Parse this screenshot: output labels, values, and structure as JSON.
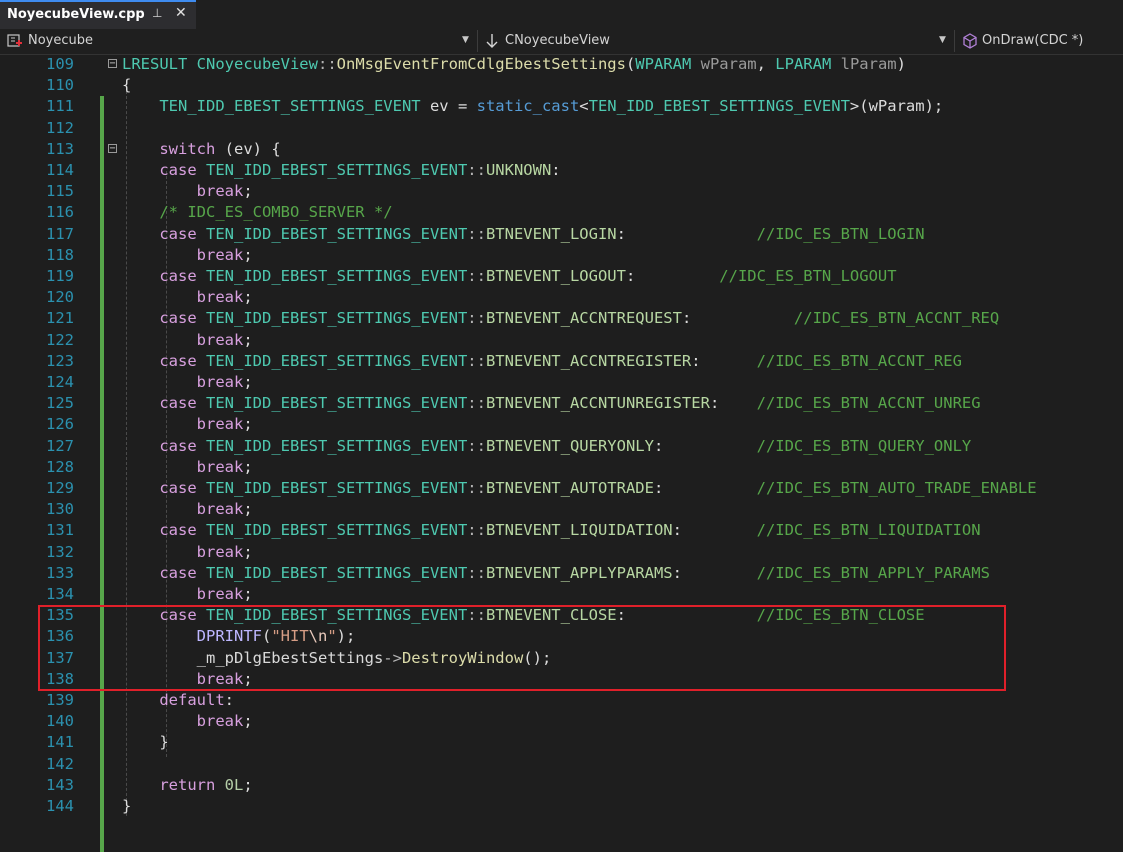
{
  "tab": {
    "title": "NoyecubeView.cpp",
    "pin_glyph": "⊥",
    "close_glyph": "✕"
  },
  "nav": {
    "project": "Noyecube",
    "class": "CNoyecubeView",
    "member": "OnDraw(CDC *)"
  },
  "lines": [
    {
      "n": "109",
      "fold": "minus",
      "segs": [
        [
          "LRESULT ",
          "type"
        ],
        [
          "CNoyecubeView",
          "type"
        ],
        [
          "::",
          "punc"
        ],
        [
          "OnMsgEventFromCdlgEbestSettings",
          "fn"
        ],
        [
          "(",
          "plain"
        ],
        [
          "WPARAM ",
          "type"
        ],
        [
          "wParam",
          "param"
        ],
        [
          ", ",
          "plain"
        ],
        [
          "LPARAM ",
          "type"
        ],
        [
          "lParam",
          "param"
        ],
        [
          ")",
          "plain"
        ]
      ]
    },
    {
      "n": "110",
      "segs": [
        [
          "{",
          "plain"
        ]
      ]
    },
    {
      "n": "111",
      "segs": [
        [
          "    ",
          "plain"
        ],
        [
          "TEN_IDD_EBEST_SETTINGS_EVENT ",
          "type"
        ],
        [
          "ev = ",
          "plain"
        ],
        [
          "static_cast",
          "kw"
        ],
        [
          "<",
          "plain"
        ],
        [
          "TEN_IDD_EBEST_SETTINGS_EVENT",
          "type"
        ],
        [
          ">(wParam);",
          "plain"
        ]
      ]
    },
    {
      "n": "112",
      "segs": []
    },
    {
      "n": "113",
      "fold": "minus",
      "segs": [
        [
          "    ",
          "plain"
        ],
        [
          "switch",
          "kw2"
        ],
        [
          " (ev) {",
          "plain"
        ]
      ]
    },
    {
      "n": "114",
      "segs": [
        [
          "    ",
          "plain"
        ],
        [
          "case ",
          "kw2"
        ],
        [
          "TEN_IDD_EBEST_SETTINGS_EVENT",
          "type"
        ],
        [
          "::",
          "punc"
        ],
        [
          "UNKNOWN",
          "enum"
        ],
        [
          ":",
          "plain"
        ]
      ]
    },
    {
      "n": "115",
      "segs": [
        [
          "        ",
          "plain"
        ],
        [
          "break",
          "kw2"
        ],
        [
          ";",
          "plain"
        ]
      ]
    },
    {
      "n": "116",
      "segs": [
        [
          "    ",
          "plain"
        ],
        [
          "/* IDC_ES_COMBO_SERVER */",
          "cmt"
        ]
      ]
    },
    {
      "n": "117",
      "segs": [
        [
          "    ",
          "plain"
        ],
        [
          "case ",
          "kw2"
        ],
        [
          "TEN_IDD_EBEST_SETTINGS_EVENT",
          "type"
        ],
        [
          "::",
          "punc"
        ],
        [
          "BTNEVENT_LOGIN",
          "enum"
        ],
        [
          ":              ",
          "plain"
        ],
        [
          "//IDC_ES_BTN_LOGIN",
          "cmt"
        ]
      ]
    },
    {
      "n": "118",
      "segs": [
        [
          "        ",
          "plain"
        ],
        [
          "break",
          "kw2"
        ],
        [
          ";",
          "plain"
        ]
      ]
    },
    {
      "n": "119",
      "segs": [
        [
          "    ",
          "plain"
        ],
        [
          "case ",
          "kw2"
        ],
        [
          "TEN_IDD_EBEST_SETTINGS_EVENT",
          "type"
        ],
        [
          "::",
          "punc"
        ],
        [
          "BTNEVENT_LOGOUT",
          "enum"
        ],
        [
          ":         ",
          "plain"
        ],
        [
          "//IDC_ES_BTN_LOGOUT",
          "cmt"
        ]
      ]
    },
    {
      "n": "120",
      "segs": [
        [
          "        ",
          "plain"
        ],
        [
          "break",
          "kw2"
        ],
        [
          ";",
          "plain"
        ]
      ]
    },
    {
      "n": "121",
      "segs": [
        [
          "    ",
          "plain"
        ],
        [
          "case ",
          "kw2"
        ],
        [
          "TEN_IDD_EBEST_SETTINGS_EVENT",
          "type"
        ],
        [
          "::",
          "punc"
        ],
        [
          "BTNEVENT_ACCNTREQUEST",
          "enum"
        ],
        [
          ":           ",
          "plain"
        ],
        [
          "//IDC_ES_BTN_ACCNT_REQ",
          "cmt"
        ]
      ]
    },
    {
      "n": "122",
      "segs": [
        [
          "        ",
          "plain"
        ],
        [
          "break",
          "kw2"
        ],
        [
          ";",
          "plain"
        ]
      ]
    },
    {
      "n": "123",
      "segs": [
        [
          "    ",
          "plain"
        ],
        [
          "case ",
          "kw2"
        ],
        [
          "TEN_IDD_EBEST_SETTINGS_EVENT",
          "type"
        ],
        [
          "::",
          "punc"
        ],
        [
          "BTNEVENT_ACCNTREGISTER",
          "enum"
        ],
        [
          ":      ",
          "plain"
        ],
        [
          "//IDC_ES_BTN_ACCNT_REG",
          "cmt"
        ]
      ]
    },
    {
      "n": "124",
      "segs": [
        [
          "        ",
          "plain"
        ],
        [
          "break",
          "kw2"
        ],
        [
          ";",
          "plain"
        ]
      ]
    },
    {
      "n": "125",
      "segs": [
        [
          "    ",
          "plain"
        ],
        [
          "case ",
          "kw2"
        ],
        [
          "TEN_IDD_EBEST_SETTINGS_EVENT",
          "type"
        ],
        [
          "::",
          "punc"
        ],
        [
          "BTNEVENT_ACCNTUNREGISTER",
          "enum"
        ],
        [
          ":    ",
          "plain"
        ],
        [
          "//IDC_ES_BTN_ACCNT_UNREG",
          "cmt"
        ]
      ]
    },
    {
      "n": "126",
      "segs": [
        [
          "        ",
          "plain"
        ],
        [
          "break",
          "kw2"
        ],
        [
          ";",
          "plain"
        ]
      ]
    },
    {
      "n": "127",
      "segs": [
        [
          "    ",
          "plain"
        ],
        [
          "case ",
          "kw2"
        ],
        [
          "TEN_IDD_EBEST_SETTINGS_EVENT",
          "type"
        ],
        [
          "::",
          "punc"
        ],
        [
          "BTNEVENT_QUERYONLY",
          "enum"
        ],
        [
          ":          ",
          "plain"
        ],
        [
          "//IDC_ES_BTN_QUERY_ONLY",
          "cmt"
        ]
      ]
    },
    {
      "n": "128",
      "segs": [
        [
          "        ",
          "plain"
        ],
        [
          "break",
          "kw2"
        ],
        [
          ";",
          "plain"
        ]
      ]
    },
    {
      "n": "129",
      "segs": [
        [
          "    ",
          "plain"
        ],
        [
          "case ",
          "kw2"
        ],
        [
          "TEN_IDD_EBEST_SETTINGS_EVENT",
          "type"
        ],
        [
          "::",
          "punc"
        ],
        [
          "BTNEVENT_AUTOTRADE",
          "enum"
        ],
        [
          ":          ",
          "plain"
        ],
        [
          "//IDC_ES_BTN_AUTO_TRADE_ENABLE",
          "cmt"
        ]
      ]
    },
    {
      "n": "130",
      "segs": [
        [
          "        ",
          "plain"
        ],
        [
          "break",
          "kw2"
        ],
        [
          ";",
          "plain"
        ]
      ]
    },
    {
      "n": "131",
      "segs": [
        [
          "    ",
          "plain"
        ],
        [
          "case ",
          "kw2"
        ],
        [
          "TEN_IDD_EBEST_SETTINGS_EVENT",
          "type"
        ],
        [
          "::",
          "punc"
        ],
        [
          "BTNEVENT_LIQUIDATION",
          "enum"
        ],
        [
          ":        ",
          "plain"
        ],
        [
          "//IDC_ES_BTN_LIQUIDATION",
          "cmt"
        ]
      ]
    },
    {
      "n": "132",
      "segs": [
        [
          "        ",
          "plain"
        ],
        [
          "break",
          "kw2"
        ],
        [
          ";",
          "plain"
        ]
      ]
    },
    {
      "n": "133",
      "segs": [
        [
          "    ",
          "plain"
        ],
        [
          "case ",
          "kw2"
        ],
        [
          "TEN_IDD_EBEST_SETTINGS_EVENT",
          "type"
        ],
        [
          "::",
          "punc"
        ],
        [
          "BTNEVENT_APPLYPARAMS",
          "enum"
        ],
        [
          ":        ",
          "plain"
        ],
        [
          "//IDC_ES_BTN_APPLY_PARAMS",
          "cmt"
        ]
      ]
    },
    {
      "n": "134",
      "segs": [
        [
          "        ",
          "plain"
        ],
        [
          "break",
          "kw2"
        ],
        [
          ";",
          "plain"
        ]
      ]
    },
    {
      "n": "135",
      "segs": [
        [
          "    ",
          "plain"
        ],
        [
          "case ",
          "kw2"
        ],
        [
          "TEN_IDD_EBEST_SETTINGS_EVENT",
          "type"
        ],
        [
          "::",
          "punc"
        ],
        [
          "BTNEVENT_CLOSE",
          "enum"
        ],
        [
          ":              ",
          "plain"
        ],
        [
          "//IDC_ES_BTN_CLOSE",
          "cmt"
        ]
      ]
    },
    {
      "n": "136",
      "segs": [
        [
          "        ",
          "plain"
        ],
        [
          "DPRINTF",
          "macro"
        ],
        [
          "(",
          "plain"
        ],
        [
          "\"HIT",
          "str"
        ],
        [
          "\\n",
          "esc"
        ],
        [
          "\"",
          "str"
        ],
        [
          ");",
          "plain"
        ]
      ]
    },
    {
      "n": "137",
      "segs": [
        [
          "        ",
          "plain"
        ],
        [
          "_m_pDlgEbestSettings",
          "member"
        ],
        [
          "->",
          "punc"
        ],
        [
          "DestroyWindow",
          "fn"
        ],
        [
          "();",
          "plain"
        ]
      ]
    },
    {
      "n": "138",
      "segs": [
        [
          "        ",
          "plain"
        ],
        [
          "break",
          "kw2"
        ],
        [
          ";",
          "plain"
        ]
      ]
    },
    {
      "n": "139",
      "segs": [
        [
          "    ",
          "plain"
        ],
        [
          "default",
          "kw2"
        ],
        [
          ":",
          "plain"
        ]
      ]
    },
    {
      "n": "140",
      "segs": [
        [
          "        ",
          "plain"
        ],
        [
          "break",
          "kw2"
        ],
        [
          ";",
          "plain"
        ]
      ]
    },
    {
      "n": "141",
      "segs": [
        [
          "    ",
          "plain"
        ],
        [
          "}",
          "plain"
        ]
      ]
    },
    {
      "n": "142",
      "segs": []
    },
    {
      "n": "143",
      "segs": [
        [
          "    ",
          "plain"
        ],
        [
          "return ",
          "kw2"
        ],
        [
          "0L",
          "num"
        ],
        [
          ";",
          "plain"
        ]
      ]
    },
    {
      "n": "144",
      "segs": [
        [
          "}",
          "plain"
        ]
      ]
    }
  ]
}
